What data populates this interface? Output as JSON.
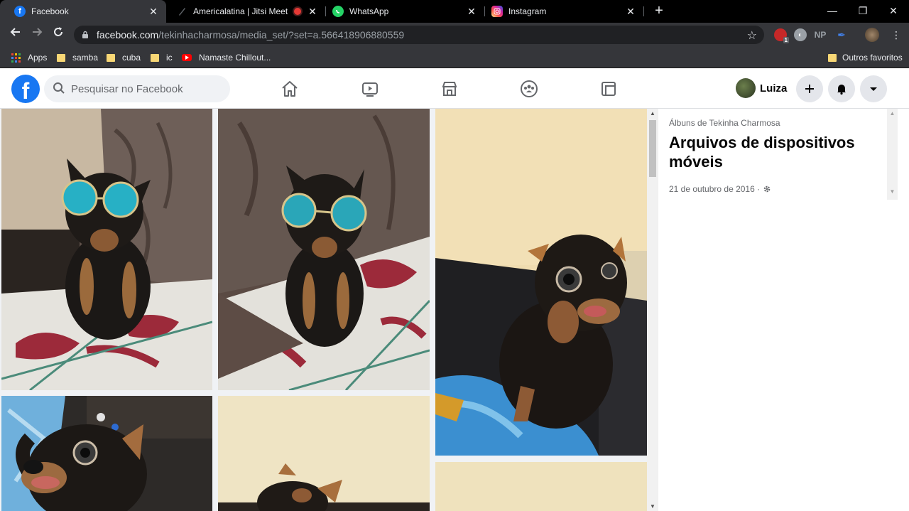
{
  "tabs": [
    {
      "title": "Facebook",
      "icon": "facebook-icon",
      "color": "#1877f2",
      "active": true
    },
    {
      "title": "Americalatina | Jitsi Meet",
      "icon": "jitsi-icon",
      "color": "#3c3c3c",
      "active": false
    },
    {
      "title": "",
      "icon": "recording-icon",
      "color": "#e53935",
      "active": false
    },
    {
      "title": "WhatsApp",
      "icon": "whatsapp-icon",
      "color": "#25d366",
      "active": false
    },
    {
      "title": "Instagram",
      "icon": "instagram-icon",
      "color": "#d6249f",
      "active": false
    }
  ],
  "toolbar": {
    "url_host": "facebook.com",
    "url_path": "/tekinhacharmosa/media_set/?set=a.566418906880559",
    "ext_np": "NP",
    "ext_badge": "1"
  },
  "bookmarks": {
    "items": [
      "Apps",
      "samba",
      "cuba",
      "ic",
      "Namaste Chillout..."
    ],
    "other": "Outros favoritos"
  },
  "facebook": {
    "search_placeholder": "Pesquisar no Facebook",
    "user_name": "Luiza",
    "brand_color": "#1877f2"
  },
  "album": {
    "owner_line": "Álbuns de Tekinha Charmosa",
    "title": "Arquivos de dispositivos móveis",
    "date": "21 de outubro de 2016 ·"
  }
}
